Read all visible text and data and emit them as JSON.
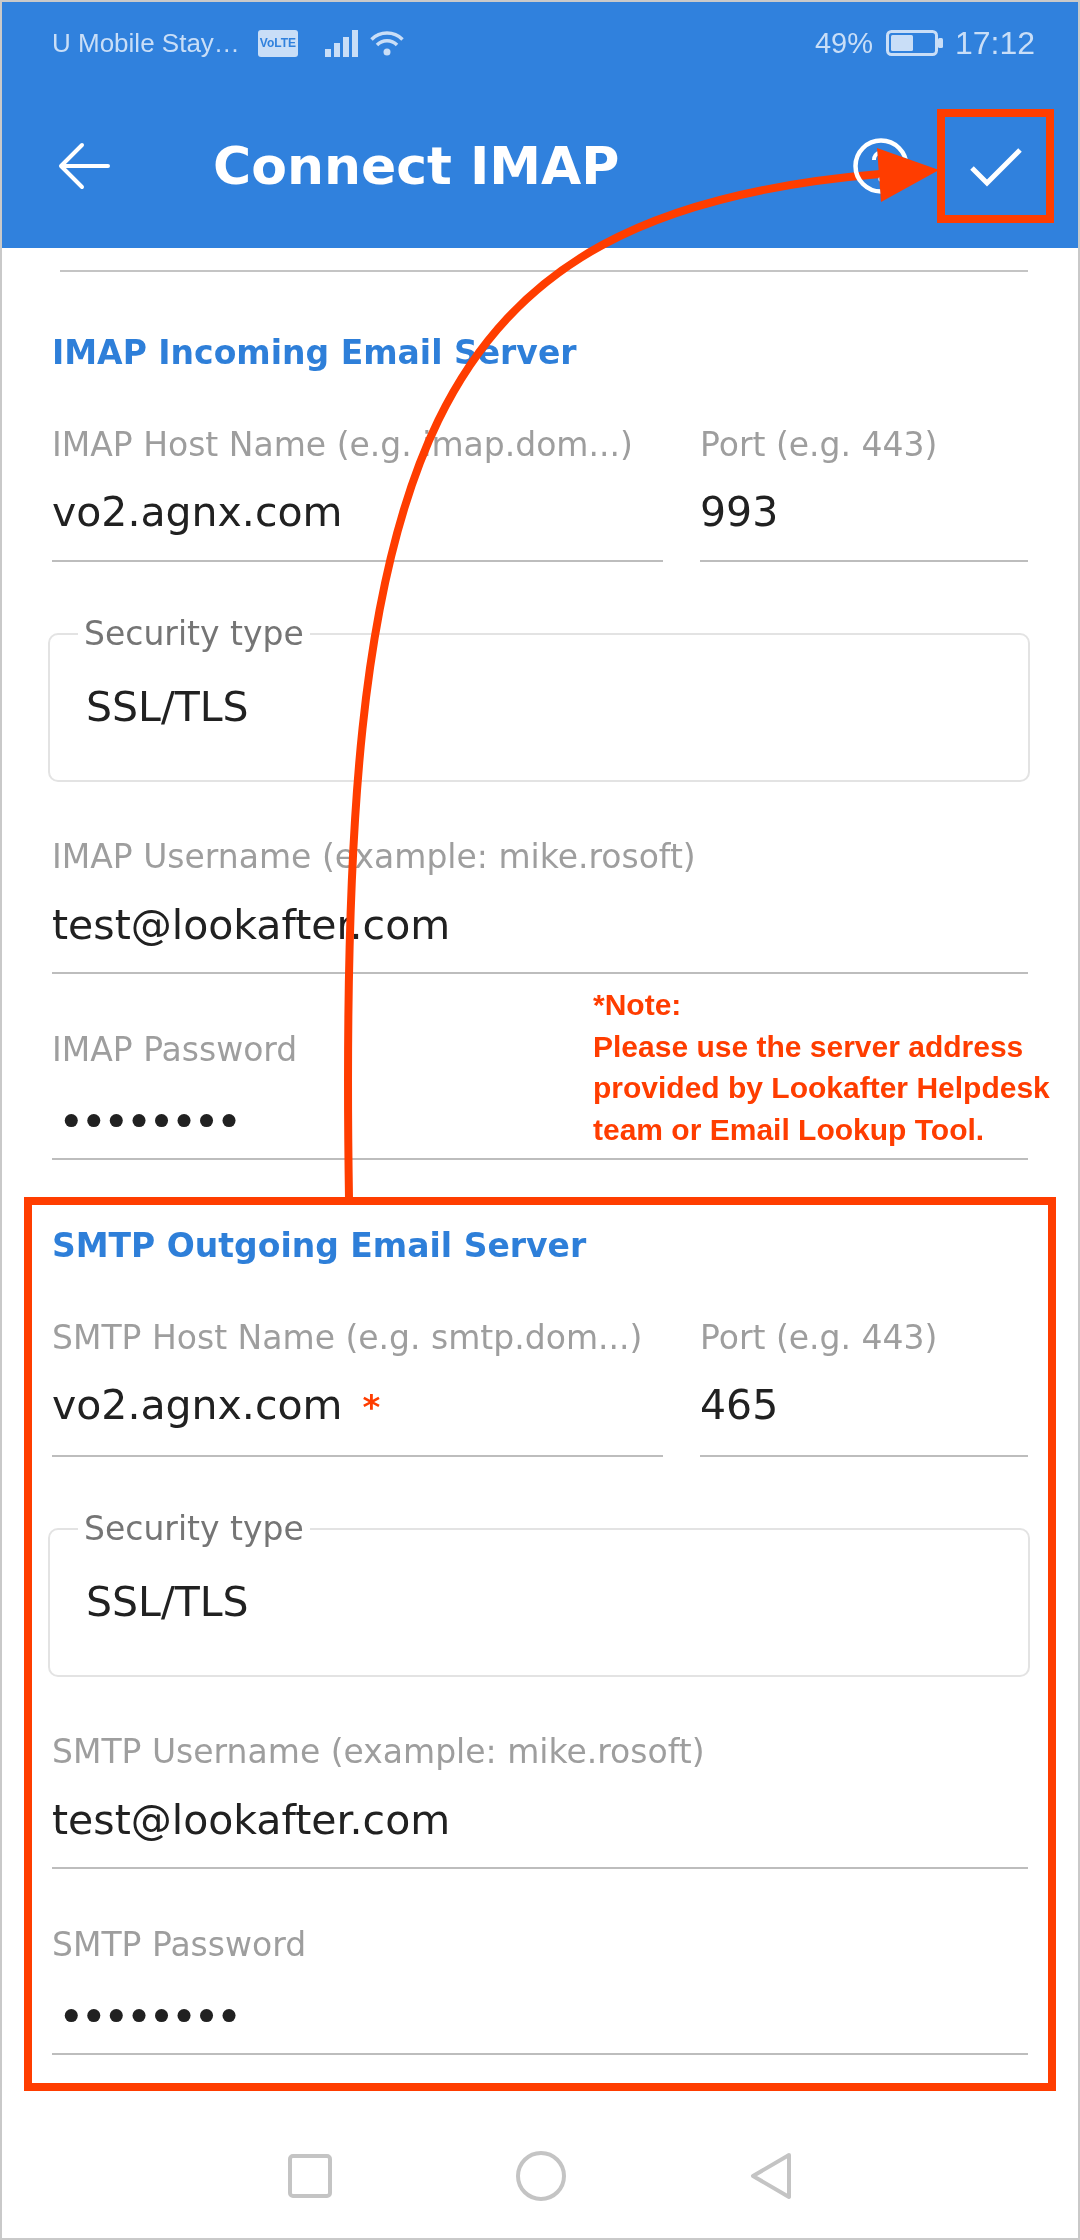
{
  "status_bar": {
    "carrier": "U Mobile Stay…",
    "network_badge": "VoLTE",
    "battery": "49%",
    "time": "17:12"
  },
  "app_bar": {
    "title": "Connect IMAP",
    "confirm_highlighted": true
  },
  "sections": [
    {
      "title": "IMAP Incoming Email Server",
      "highlighted": false,
      "host": {
        "label": "IMAP Host Name (e.g. imap.dom...)",
        "value": "vo2.agnx.com"
      },
      "port": {
        "label": "Port (e.g. 443)",
        "value": "993"
      },
      "security": {
        "label": "Security type",
        "value": "SSL/TLS"
      },
      "username": {
        "label": "IMAP Username (example: mike.rosoft)",
        "value": "test@lookafter.com"
      },
      "password": {
        "label": "IMAP Password",
        "value": "••••••••"
      },
      "note": {
        "title": "*Note:",
        "lines": [
          "Please use the server address",
          "provided by Lookafter Helpdesk",
          "team or Email Lookup Tool."
        ]
      }
    },
    {
      "title": "SMTP Outgoing Email Server",
      "highlighted": true,
      "host": {
        "label": "SMTP Host Name (e.g. smtp.dom...)",
        "value": "vo2.agnx.com",
        "mark": "*"
      },
      "port": {
        "label": "Port (e.g. 443)",
        "value": "465"
      },
      "security": {
        "label": "Security type",
        "value": "SSL/TLS"
      },
      "username": {
        "label": "SMTP Username (example: mike.rosoft)",
        "value": "test@lookafter.com"
      },
      "password": {
        "label": "SMTP Password",
        "value": "••••••••"
      }
    }
  ]
}
